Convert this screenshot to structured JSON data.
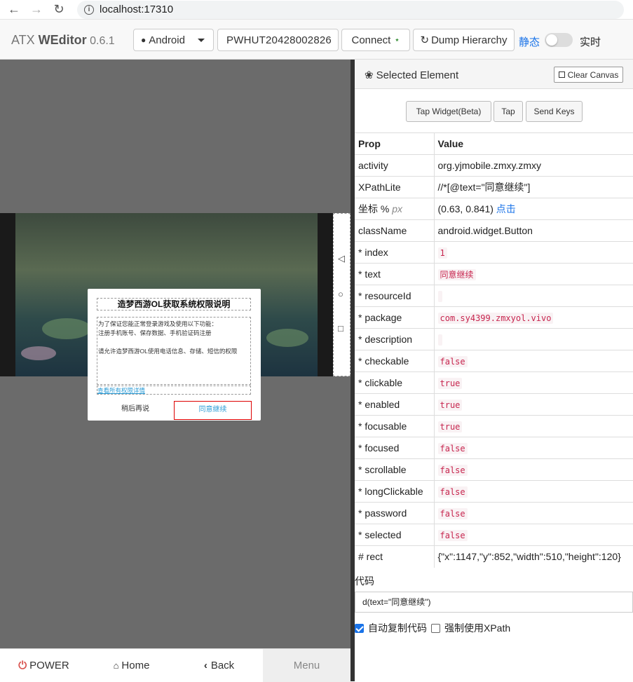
{
  "browser": {
    "url": "localhost:17310"
  },
  "toolbar": {
    "brand_prefix": "ATX ",
    "brand_name": "WEditor",
    "version": " 0.6.1",
    "platform": "Android",
    "serial": "PWHUT20428002826",
    "connect_label": "Connect",
    "dump_label": "Dump Hierarchy",
    "static_label": "静态",
    "live_label": "实时",
    "live_mode_on": false
  },
  "device_dialog": {
    "title": "造梦西游OL获取系统权限说明",
    "body_line1": "为了保证您能正常登录游戏及使用以下功能：",
    "body_line2": "注册手机账号、保存数据、手机验证码注册",
    "body_line3": "请允许造梦西游OL使用电话信息、存储、短信的权限",
    "link": "查看所有权限详情",
    "later": "稍后再说",
    "agree": "同意继续"
  },
  "nav_icons": [
    "back-triangle-icon",
    "home-circle-icon",
    "recents-square-icon"
  ],
  "bottom_bar": {
    "power": "POWER",
    "home": "Home",
    "back": "Back",
    "menu": "Menu"
  },
  "selected": {
    "title": "Selected Element",
    "clear_canvas": "Clear Canvas",
    "actions": [
      "Tap Widget(Beta)",
      "Tap",
      "Send Keys"
    ],
    "header_prop": "Prop",
    "header_value": "Value",
    "activity_k": "activity",
    "activity_v": "org.yjmobile.zmxy.zmxy",
    "xpath_k": "XPathLite",
    "xpath_v": "//*[@text=\"同意继续\"]",
    "coord_k": "坐标 %",
    "coord_px": "px",
    "coord_v": "(0.63, 0.841)",
    "coord_link": "点击",
    "class_k": "className",
    "class_v": "android.widget.Button",
    "index_k": "* index",
    "index_v": "1",
    "text_k": "* text",
    "text_v": "同意继续",
    "rid_k": "* resourceId",
    "rid_v": "",
    "pkg_k": "* package",
    "pkg_v": "com.sy4399.zmxyol.vivo",
    "desc_k": "* description",
    "desc_v": "",
    "checkable_k": "* checkable",
    "checkable_v": "false",
    "clickable_k": "* clickable",
    "clickable_v": "true",
    "enabled_k": "* enabled",
    "enabled_v": "true",
    "focusable_k": "* focusable",
    "focusable_v": "true",
    "focused_k": "* focused",
    "focused_v": "false",
    "scrollable_k": "* scrollable",
    "scrollable_v": "false",
    "longclick_k": "* longClickable",
    "longclick_v": "false",
    "password_k": "* password",
    "password_v": "false",
    "selected_k": "* selected",
    "selected_v": "false",
    "rect_k": "# rect",
    "rect_v": "{\"x\":1147,\"y\":852,\"width\":510,\"height\":120}"
  },
  "code": {
    "label": "代码",
    "value": "d(text=\"同意继续\")",
    "auto_copy_label": "自动复制代码",
    "auto_copy_checked": true,
    "force_xpath_label": "强制使用XPath",
    "force_xpath_checked": false
  }
}
